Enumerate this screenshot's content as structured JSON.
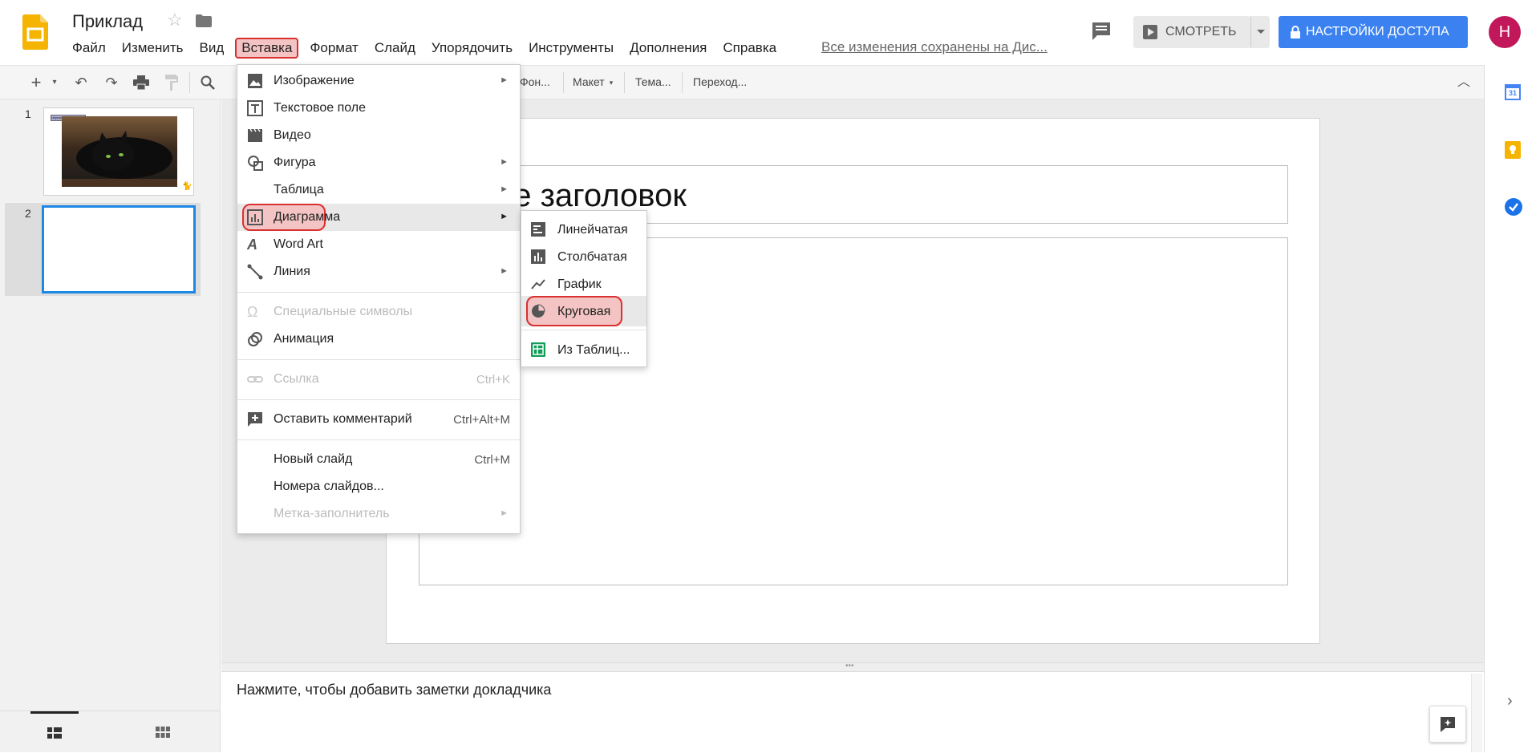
{
  "document": {
    "title": "Приклад",
    "save_status": "Все изменения сохранены на Дис..."
  },
  "menubar": {
    "file": "Файл",
    "edit": "Изменить",
    "view": "Вид",
    "insert": "Вставка",
    "format": "Формат",
    "slide": "Слайд",
    "arrange": "Упорядочить",
    "tools": "Инструменты",
    "addons": "Дополнения",
    "help": "Справка"
  },
  "header": {
    "present_label": "СМОТРЕТЬ",
    "share_label": "НАСТРОЙКИ ДОСТУПА",
    "avatar_letter": "Н"
  },
  "toolbar": {
    "background": "Фон...",
    "layout": "Макет",
    "theme": "Тема...",
    "transition": "Переход..."
  },
  "insert_menu": {
    "image": "Изображение",
    "text_box": "Текстовое поле",
    "video": "Видео",
    "shape": "Фигура",
    "table": "Таблица",
    "chart": "Диаграмма",
    "word_art": "Word Art",
    "line": "Линия",
    "special_chars": "Специальные символы",
    "animation": "Анимация",
    "link": "Ссылка",
    "link_shortcut": "Ctrl+K",
    "comment": "Оставить комментарий",
    "comment_shortcut": "Ctrl+Alt+M",
    "new_slide": "Новый слайд",
    "new_slide_shortcut": "Ctrl+M",
    "slide_numbers": "Номера слайдов...",
    "placeholder": "Метка-заполнитель"
  },
  "chart_submenu": {
    "bar": "Линейчатая",
    "column": "Столбчатая",
    "line": "График",
    "pie": "Круговая",
    "from_sheets": "Из Таблиц..."
  },
  "filmstrip": {
    "slide1_num": "1",
    "slide2_num": "2",
    "slide1_caption": "Черная кошка"
  },
  "slide": {
    "title_placeholder": "ите заголовок"
  },
  "notes": {
    "placeholder": "Нажмите, чтобы добавить заметки докладчика"
  },
  "side_panel": {
    "calendar_day": "31"
  },
  "colors": {
    "accent": "#3b82f0",
    "highlight_fill": "#f4c4c4",
    "highlight_border": "#d93030",
    "avatar": "#c2185b"
  }
}
